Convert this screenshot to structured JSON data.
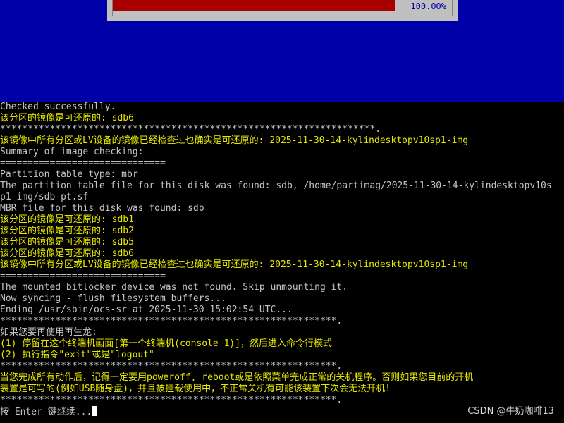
{
  "progress": {
    "percent_text": "100.00%",
    "fraction": 1.0
  },
  "colors": {
    "background": "#000000",
    "blue_area": "#0000a8",
    "progress_fill": "#a80000",
    "yellow_text": "#e8e800",
    "gray_text": "#a8a8a8"
  },
  "terminal": {
    "lines": [
      {
        "text": "Checked successfully.",
        "color": "w"
      },
      {
        "text": "该分区的镜像是可还原的: sdb6",
        "color": "y"
      },
      {
        "text": "********************************************************************.",
        "color": "w"
      },
      {
        "text": "该镜像中所有分区或LV设备的镜像已经检查过也确实是可还原的: 2025-11-30-14-kylindesktopv10sp1-img",
        "color": "y"
      },
      {
        "text": "Summary of image checking:",
        "color": "w"
      },
      {
        "text": "==============================",
        "color": "w"
      },
      {
        "text": "Partition table type: mbr",
        "color": "w"
      },
      {
        "text": "The partition table file for this disk was found: sdb, /home/partimag/2025-11-30-14-kylindesktopv10s",
        "color": "w"
      },
      {
        "text": "p1-img/sdb-pt.sf",
        "color": "w"
      },
      {
        "text": "MBR file for this disk was found: sdb",
        "color": "w"
      },
      {
        "text": "该分区的镜像是可还原的: sdb1",
        "color": "y"
      },
      {
        "text": "该分区的镜像是可还原的: sdb2",
        "color": "y"
      },
      {
        "text": "该分区的镜像是可还原的: sdb5",
        "color": "y"
      },
      {
        "text": "该分区的镜像是可还原的: sdb6",
        "color": "y"
      },
      {
        "text": "该镜像中所有分区或LV设备的镜像已经检查过也确实是可还原的: 2025-11-30-14-kylindesktopv10sp1-img",
        "color": "y"
      },
      {
        "text": "==============================",
        "color": "w"
      },
      {
        "text": "The mounted bitlocker device was not found. Skip unmounting it.",
        "color": "w"
      },
      {
        "text": "Now syncing - flush filesystem buffers...",
        "color": "w"
      },
      {
        "text": "Ending /usr/sbin/ocs-sr at 2025-11-30 15:02:54 UTC...",
        "color": "w"
      },
      {
        "text": "*************************************************************.",
        "color": "w"
      },
      {
        "text": "如果您要再使用再生龙:",
        "color": "w"
      },
      {
        "text": "(1) 停留在这个终端机画面[第一个终端机(console 1)]，然后进入命令行模式",
        "color": "y"
      },
      {
        "text": "(2) 执行指令\"exit\"或是\"logout\"",
        "color": "y"
      },
      {
        "text": "*************************************************************.",
        "color": "w"
      },
      {
        "text": "当您完成所有动作后，记得一定要用poweroff, reboot或是依照菜单完成正常的关机程序。否则如果您目前的开机",
        "color": "y"
      },
      {
        "text": "装置是可写的(例如USB随身盘)，并且被挂载使用中，不正常关机有可能该装置下次会无法开机!",
        "color": "y"
      },
      {
        "text": "*************************************************************.",
        "color": "w"
      }
    ],
    "prompt": "按 Enter 键继续..."
  },
  "watermark": "CSDN @牛奶咖啡13"
}
